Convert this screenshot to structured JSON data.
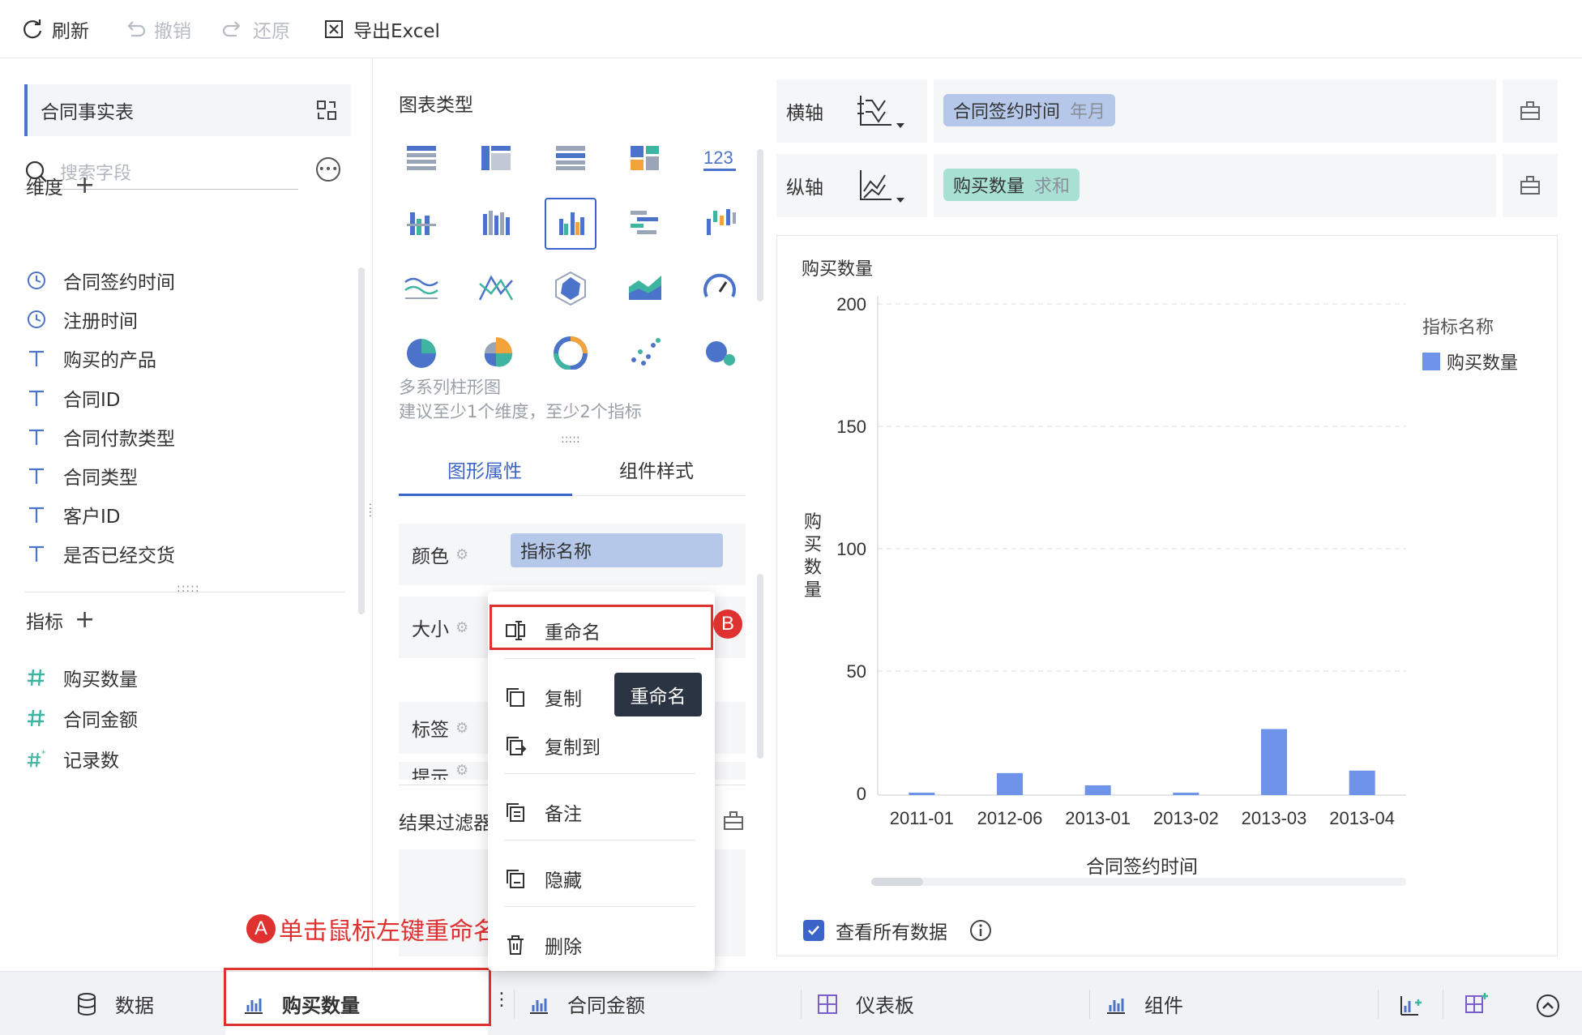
{
  "toolbar": {
    "refresh": "刷新",
    "undo": "撤销",
    "redo": "还原",
    "export": "导出Excel"
  },
  "left": {
    "table_name": "合同事实表",
    "search_placeholder": "搜索字段",
    "dimension_title": "维度",
    "dimensions": [
      {
        "label": "合同签约时间",
        "icon": "clock-icon"
      },
      {
        "label": "注册时间",
        "icon": "clock-icon"
      },
      {
        "label": "购买的产品",
        "icon": "text-type-icon"
      },
      {
        "label": "合同ID",
        "icon": "text-type-icon"
      },
      {
        "label": "合同付款类型",
        "icon": "text-type-icon"
      },
      {
        "label": "合同类型",
        "icon": "text-type-icon"
      },
      {
        "label": "客户ID",
        "icon": "text-type-icon"
      },
      {
        "label": "是否已经交货",
        "icon": "text-type-icon"
      }
    ],
    "metric_title": "指标",
    "metrics": [
      {
        "label": "购买数量",
        "icon": "number-icon"
      },
      {
        "label": "合同金额",
        "icon": "number-icon"
      },
      {
        "label": "记录数",
        "icon": "number-star-icon"
      }
    ]
  },
  "middle": {
    "chart_type_title": "图表类型",
    "chart_name": "多系列柱形图",
    "chart_hint": "建议至少1个维度，至少2个指标",
    "tab_graph": "图形属性",
    "tab_style": "组件样式",
    "prop_color": "颜色",
    "prop_color_value": "指标名称",
    "prop_size": "大小",
    "prop_label": "标签",
    "prop_tooltip": "提示",
    "result_filter": "结果过滤器"
  },
  "axes": {
    "x_label": "横轴",
    "x_field": "合同签约时间",
    "x_field_sub": "年月",
    "y_label": "纵轴",
    "y_field": "购买数量",
    "y_field_sub": "求和"
  },
  "chart_data": {
    "type": "bar",
    "title": "购买数量",
    "categories": [
      "2011-01",
      "2012-06",
      "2013-01",
      "2013-02",
      "2013-03",
      "2013-04"
    ],
    "series": [
      {
        "name": "购买数量",
        "values": [
          1,
          9,
          4,
          1,
          27,
          10
        ]
      }
    ],
    "xlabel": "合同签约时间",
    "ylabel": "购买数量",
    "yticks": [
      0,
      50,
      100,
      150,
      200
    ],
    "ylim": [
      0,
      200
    ],
    "legend_title": "指标名称",
    "legend_position": "top-right",
    "bar_color": "#6f93e8",
    "grid": true
  },
  "chart_footer": {
    "view_all": "查看所有数据"
  },
  "context_menu": {
    "rename": "重命名",
    "copy": "复制",
    "copy_to": "复制到",
    "note": "备注",
    "hide": "隐藏",
    "delete": "删除",
    "tooltip": "重命名"
  },
  "annotations": {
    "badge_a": "A",
    "badge_b": "B",
    "text_a": "单击鼠标左键重命名"
  },
  "footer": {
    "data": "数据",
    "tab1": "购买数量",
    "tab2": "合同金额",
    "tab3": "仪表板",
    "tab4": "组件"
  },
  "colors": {
    "accent": "#3b64c8",
    "highlight": "#e03131",
    "pill_x": "#b6c8ea",
    "pill_y": "#a9e0d4"
  }
}
